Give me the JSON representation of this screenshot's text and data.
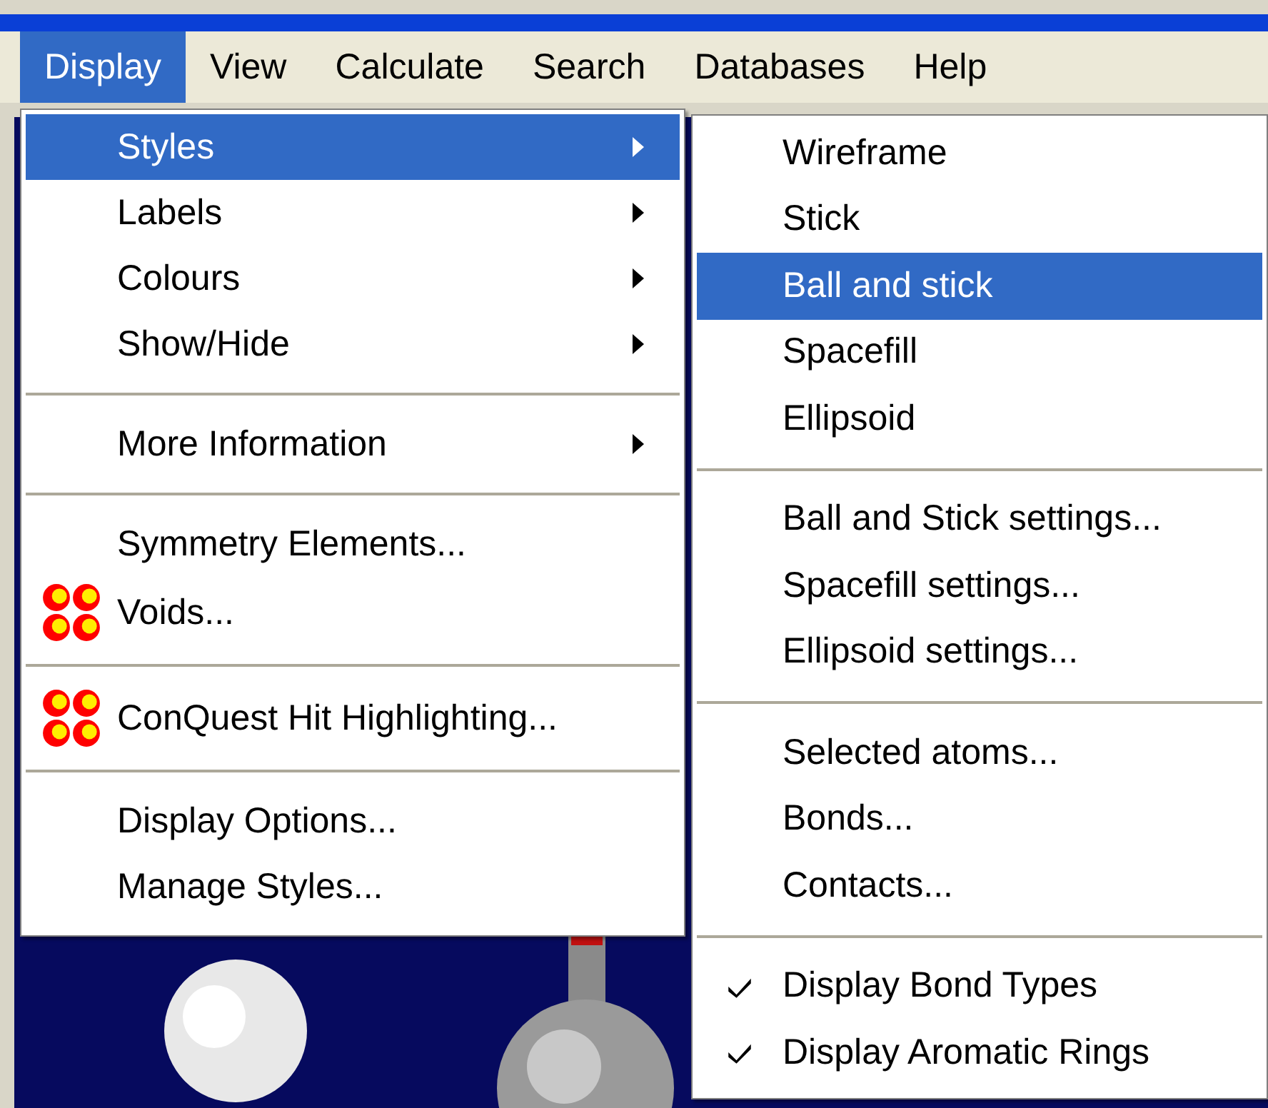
{
  "menubar": [
    {
      "label": "Display",
      "selected": true
    },
    {
      "label": "View",
      "selected": false
    },
    {
      "label": "Calculate",
      "selected": false
    },
    {
      "label": "Search",
      "selected": false
    },
    {
      "label": "Databases",
      "selected": false
    },
    {
      "label": "Help",
      "selected": false
    }
  ],
  "display_menu": [
    {
      "kind": "item",
      "label": "Styles",
      "submenu": true,
      "selected": true,
      "icon": false
    },
    {
      "kind": "item",
      "label": "Labels",
      "submenu": true,
      "selected": false,
      "icon": false
    },
    {
      "kind": "item",
      "label": "Colours",
      "submenu": true,
      "selected": false,
      "icon": false
    },
    {
      "kind": "item",
      "label": "Show/Hide",
      "submenu": true,
      "selected": false,
      "icon": false
    },
    {
      "kind": "separator"
    },
    {
      "kind": "item",
      "label": "More Information",
      "submenu": true,
      "selected": false,
      "icon": false
    },
    {
      "kind": "separator"
    },
    {
      "kind": "item",
      "label": "Symmetry Elements...",
      "submenu": false,
      "selected": false,
      "icon": false
    },
    {
      "kind": "item",
      "label": "Voids...",
      "submenu": false,
      "selected": false,
      "icon": true
    },
    {
      "kind": "separator"
    },
    {
      "kind": "item",
      "label": "ConQuest Hit Highlighting...",
      "submenu": false,
      "selected": false,
      "icon": true
    },
    {
      "kind": "separator"
    },
    {
      "kind": "item",
      "label": "Display Options...",
      "submenu": false,
      "selected": false,
      "icon": false
    },
    {
      "kind": "item",
      "label": "Manage Styles...",
      "submenu": false,
      "selected": false,
      "icon": false
    }
  ],
  "styles_submenu": [
    {
      "kind": "item",
      "label": "Wireframe",
      "selected": false,
      "checked": false
    },
    {
      "kind": "item",
      "label": "Stick",
      "selected": false,
      "checked": false
    },
    {
      "kind": "item",
      "label": "Ball and stick",
      "selected": true,
      "checked": false
    },
    {
      "kind": "item",
      "label": "Spacefill",
      "selected": false,
      "checked": false
    },
    {
      "kind": "item",
      "label": "Ellipsoid",
      "selected": false,
      "checked": false
    },
    {
      "kind": "separator"
    },
    {
      "kind": "item",
      "label": "Ball and Stick settings...",
      "selected": false,
      "checked": false
    },
    {
      "kind": "item",
      "label": "Spacefill settings...",
      "selected": false,
      "checked": false
    },
    {
      "kind": "item",
      "label": "Ellipsoid settings...",
      "selected": false,
      "checked": false
    },
    {
      "kind": "separator"
    },
    {
      "kind": "item",
      "label": "Selected atoms...",
      "selected": false,
      "checked": false
    },
    {
      "kind": "item",
      "label": "Bonds...",
      "selected": false,
      "checked": false
    },
    {
      "kind": "item",
      "label": "Contacts...",
      "selected": false,
      "checked": false
    },
    {
      "kind": "separator"
    },
    {
      "kind": "item",
      "label": "Display Bond Types",
      "selected": false,
      "checked": true
    },
    {
      "kind": "item",
      "label": "Display Aromatic Rings",
      "selected": false,
      "checked": true
    }
  ]
}
